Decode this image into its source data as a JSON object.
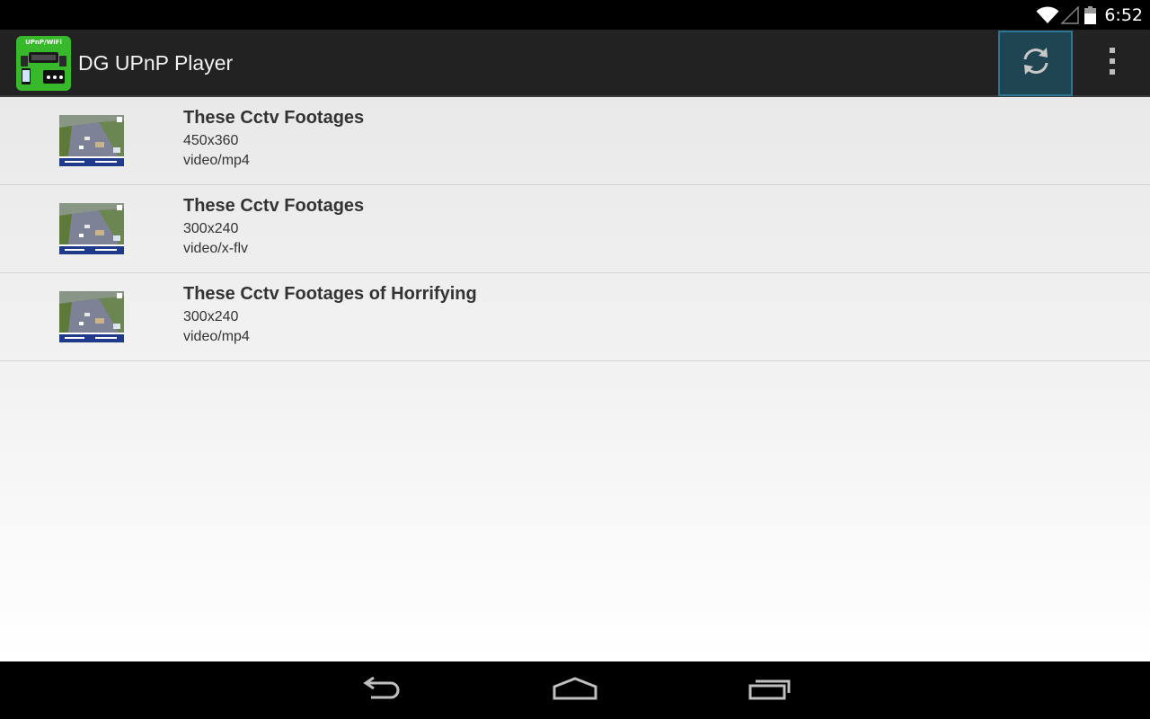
{
  "status_bar": {
    "time": "6:52"
  },
  "action_bar": {
    "app_icon_text": "UPnP/WiFi",
    "title": "DG UPnP Player"
  },
  "items": [
    {
      "title": "These Cctv Footages",
      "resolution": "450x360",
      "mime": "video/mp4"
    },
    {
      "title": "These Cctv Footages",
      "resolution": "300x240",
      "mime": "video/x-flv"
    },
    {
      "title": "These Cctv Footages of Horrifying",
      "resolution": "300x240",
      "mime": "video/mp4"
    }
  ],
  "icons": {
    "wifi": "wifi-icon",
    "signal": "signal-icon",
    "battery": "battery-icon",
    "refresh": "refresh-icon",
    "overflow": "overflow-menu-icon",
    "back": "back-icon",
    "home": "home-icon",
    "recents": "recents-icon"
  },
  "colors": {
    "accent": "#2d7794",
    "app_icon": "#38b82b",
    "action_bar": "#222222"
  }
}
